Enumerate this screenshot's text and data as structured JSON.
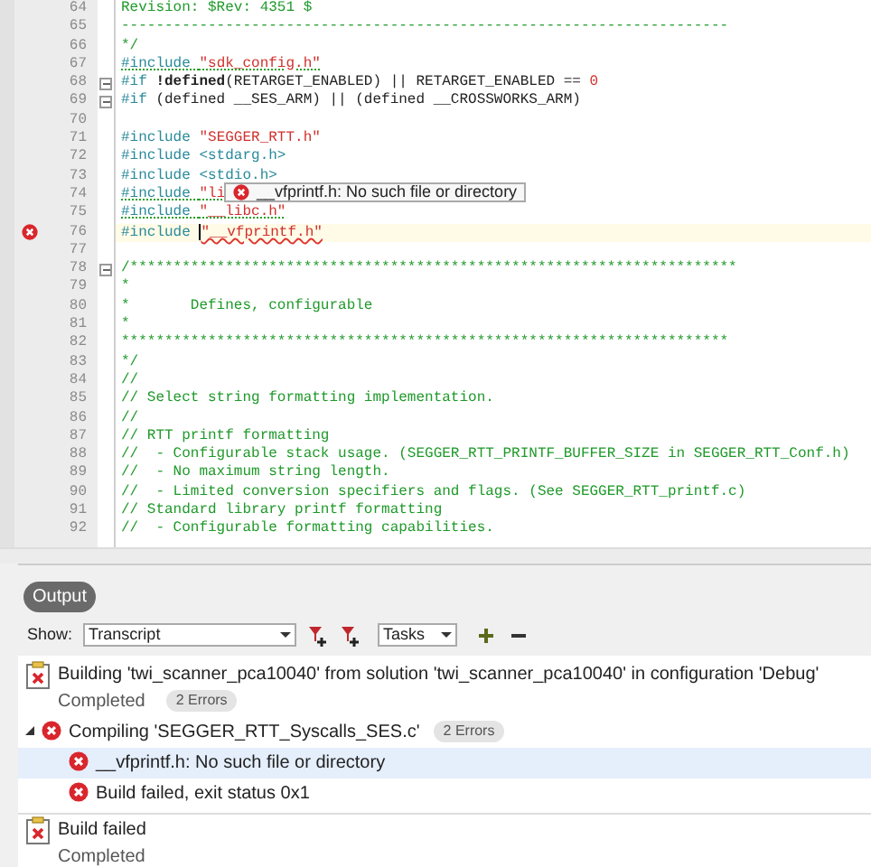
{
  "editor": {
    "lines": [
      {
        "number": "64",
        "tokens": [
          {
            "kind": "comment",
            "t": "Revision: $Rev: 4351 $"
          }
        ]
      },
      {
        "number": "65",
        "tokens": [
          {
            "kind": "comment",
            "t": "----------------------------------------------------------------------"
          }
        ]
      },
      {
        "number": "66",
        "tokens": [
          {
            "kind": "comment",
            "t": "*/"
          }
        ]
      },
      {
        "number": "67",
        "tokens": [
          {
            "kind": "pp",
            "t": "#include ",
            "warning": true
          },
          {
            "kind": "str",
            "t": "\"sdk_config.h\"",
            "warning": true
          }
        ]
      },
      {
        "number": "68",
        "fold": true,
        "tokens": [
          {
            "kind": "pp",
            "t": "#if "
          },
          {
            "kind": "kw",
            "t": "!defined"
          },
          {
            "kind": "plain",
            "t": "(RETARGET_ENABLED) || RETARGET_ENABLED == "
          },
          {
            "kind": "num",
            "t": "0"
          }
        ]
      },
      {
        "number": "69",
        "fold": true,
        "tokens": [
          {
            "kind": "pp",
            "t": "#if "
          },
          {
            "kind": "plain",
            "t": "(defined __SES_ARM) || (defined __CROSSWORKS_ARM)"
          }
        ]
      },
      {
        "number": "70"
      },
      {
        "number": "71",
        "tokens": [
          {
            "kind": "pp",
            "t": "#include "
          },
          {
            "kind": "str",
            "t": "\"SEGGER_RTT.h\""
          }
        ]
      },
      {
        "number": "72",
        "tokens": [
          {
            "kind": "pp",
            "t": "#include <stdarg.h>"
          }
        ]
      },
      {
        "number": "73",
        "tokens": [
          {
            "kind": "pp",
            "t": "#include <stdio.h>"
          }
        ]
      },
      {
        "number": "74",
        "tokens": [
          {
            "kind": "pp",
            "t": "#include ",
            "warning": true
          },
          {
            "kind": "str",
            "t": "\"li",
            "warning": true
          }
        ]
      },
      {
        "number": "75",
        "tokens": [
          {
            "kind": "pp",
            "t": "#include ",
            "warning": true
          },
          {
            "kind": "str",
            "t": "\"__libc.h\"",
            "warning": true
          }
        ]
      },
      {
        "number": "76",
        "error": true,
        "current": true,
        "tokens": [
          {
            "kind": "pp",
            "t": "#include "
          },
          {
            "kind": "cursor"
          },
          {
            "kind": "str",
            "t": "\"__vfprintf.h\"",
            "error": true
          }
        ]
      },
      {
        "number": "77"
      },
      {
        "number": "78",
        "fold": true,
        "tokens": [
          {
            "kind": "comment",
            "t": "/**********************************************************************"
          }
        ]
      },
      {
        "number": "79",
        "tokens": [
          {
            "kind": "comment",
            "t": "*"
          }
        ]
      },
      {
        "number": "80",
        "tokens": [
          {
            "kind": "comment",
            "t": "*       Defines, configurable"
          }
        ]
      },
      {
        "number": "81",
        "tokens": [
          {
            "kind": "comment",
            "t": "*"
          }
        ]
      },
      {
        "number": "82",
        "tokens": [
          {
            "kind": "comment",
            "t": "**********************************************************************"
          }
        ]
      },
      {
        "number": "83",
        "tokens": [
          {
            "kind": "comment",
            "t": "*/"
          }
        ]
      },
      {
        "number": "84",
        "tokens": [
          {
            "kind": "comment",
            "t": "//"
          }
        ]
      },
      {
        "number": "85",
        "tokens": [
          {
            "kind": "comment",
            "t": "// Select string formatting implementation."
          }
        ]
      },
      {
        "number": "86",
        "tokens": [
          {
            "kind": "comment",
            "t": "//"
          }
        ]
      },
      {
        "number": "87",
        "tokens": [
          {
            "kind": "comment",
            "t": "// RTT printf formatting"
          }
        ]
      },
      {
        "number": "88",
        "tokens": [
          {
            "kind": "comment",
            "t": "//  - Configurable stack usage. (SEGGER_RTT_PRINTF_BUFFER_SIZE in SEGGER_RTT_Conf.h)"
          }
        ]
      },
      {
        "number": "89",
        "tokens": [
          {
            "kind": "comment",
            "t": "//  - No maximum string length."
          }
        ]
      },
      {
        "number": "90",
        "tokens": [
          {
            "kind": "comment",
            "t": "//  - Limited conversion specifiers and flags. (See SEGGER_RTT_printf.c)"
          }
        ]
      },
      {
        "number": "91",
        "tokens": [
          {
            "kind": "comment",
            "t": "// Standard library printf formatting"
          }
        ]
      },
      {
        "number": "92",
        "tokens": [
          {
            "kind": "comment",
            "t": "//  - Configurable formatting capabilities."
          }
        ]
      }
    ]
  },
  "tooltip": {
    "text": "__vfprintf.h: No such file or directory"
  },
  "output": {
    "tab": "Output",
    "show_label": "Show:",
    "show_value": "Transcript",
    "filter_value": "Tasks",
    "entries": [
      {
        "kind": "build",
        "selected": false,
        "title": "Building 'twi_scanner_pca10040' from solution 'twi_scanner_pca10040' in configuration 'Debug'",
        "status": "Completed",
        "badge": "2 Errors"
      },
      {
        "kind": "error",
        "selected": false,
        "expanded": true,
        "title": "Compiling 'SEGGER_RTT_Syscalls_SES.c'",
        "badge": "2 Errors",
        "children": [
          {
            "kind": "error",
            "selected": true,
            "title": "__vfprintf.h: No such file or directory"
          },
          {
            "kind": "error",
            "selected": false,
            "title": "Build failed, exit status 0x1"
          }
        ]
      },
      {
        "kind": "build",
        "selected": false,
        "title": "Build failed",
        "status": "Completed"
      }
    ]
  }
}
